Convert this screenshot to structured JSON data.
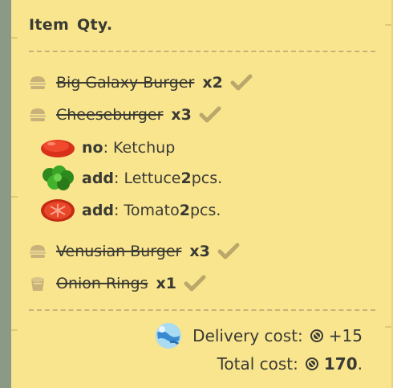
{
  "header": {
    "item_label": "Item",
    "qty_label": "Qty."
  },
  "order_items": [
    {
      "name": "Big Galaxy Burger",
      "qty": "x2",
      "icon": "burger-icon",
      "done": true
    },
    {
      "name": "Cheeseburger",
      "qty": "x3",
      "icon": "burger-icon",
      "done": true,
      "modifiers": [
        {
          "action": "no",
          "text": ": Ketchup",
          "icon": "ketchup-icon"
        },
        {
          "action": "add",
          "text_before": ": Lettuce ",
          "amount": "2",
          "text_after": " pcs.",
          "icon": "lettuce-icon"
        },
        {
          "action": "add",
          "text_before": ": Tomato ",
          "amount": "2",
          "text_after": " pcs.",
          "icon": "tomato-icon"
        }
      ]
    },
    {
      "name": "Venusian Burger",
      "qty": "x3",
      "icon": "burger-icon",
      "done": true
    },
    {
      "name": "Onion Rings",
      "qty": "x1",
      "icon": "onion-rings-icon",
      "done": true
    }
  ],
  "delivery": {
    "label": "Delivery cost:",
    "value": "+15",
    "icon": "planet-icon"
  },
  "total": {
    "label": "Total cost:",
    "value": "170",
    "suffix": "."
  },
  "colors": {
    "paper": "#f9e58e",
    "text": "#3a3a34",
    "check": "#b9a86a"
  }
}
